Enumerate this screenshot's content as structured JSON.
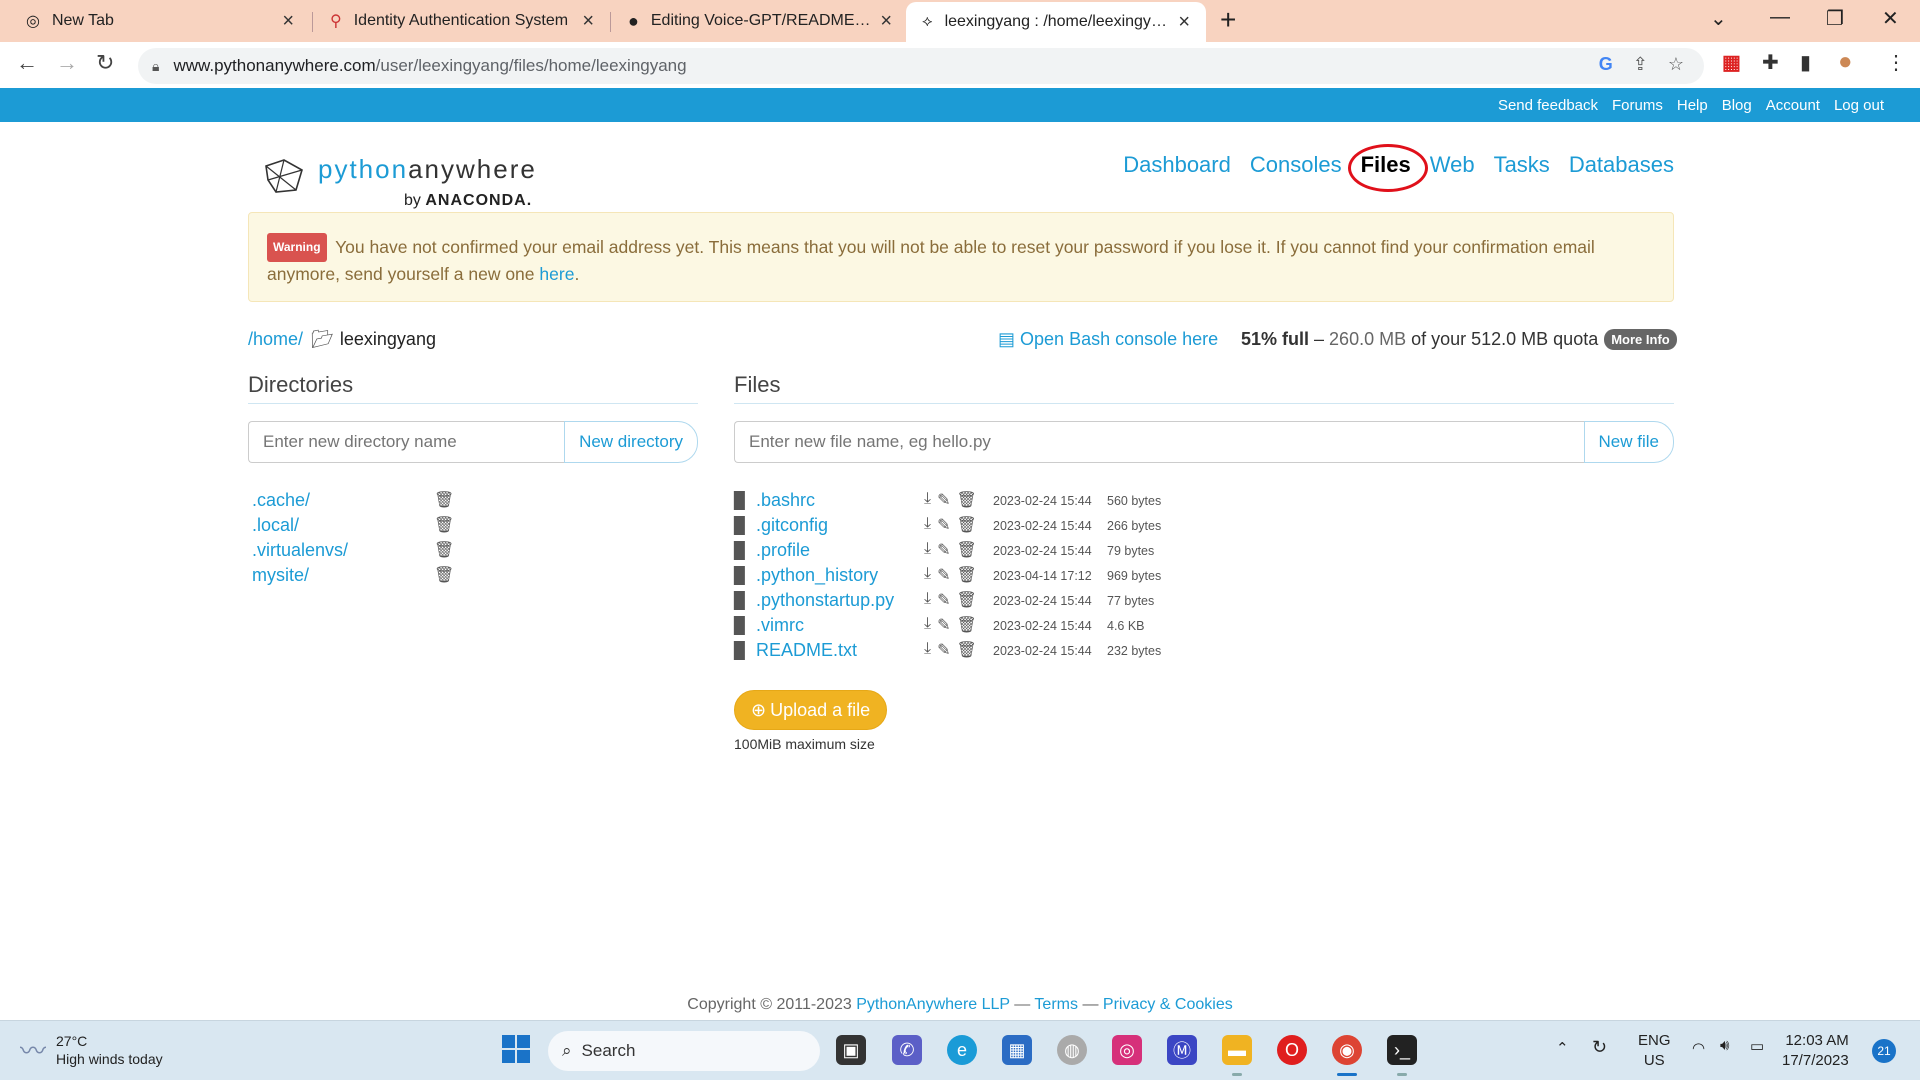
{
  "browser": {
    "tabs": [
      {
        "label": "New Tab",
        "icon": "chrome-icon"
      },
      {
        "label": "Identity Authentication System",
        "icon": "map-pin-icon"
      },
      {
        "label": "Editing Voice-GPT/README.md a",
        "icon": "github-icon"
      },
      {
        "label": "leexingyang : /home/leexingyang",
        "icon": "pythonanywhere-icon",
        "active": true
      }
    ],
    "url_host": "www.pythonanywhere.com",
    "url_path": "/user/leexingyang/files/home/leexingyang"
  },
  "pa_topbar": {
    "links": [
      "Send feedback",
      "Forums",
      "Help",
      "Blog",
      "Account",
      "Log out"
    ]
  },
  "logo": {
    "python": "python",
    "anywhere": "anywhere",
    "by": "by",
    "anaconda": "ANACONDA."
  },
  "nav": {
    "items": [
      "Dashboard",
      "Consoles",
      "Files",
      "Web",
      "Tasks",
      "Databases"
    ],
    "current": "Files"
  },
  "warning": {
    "badge": "Warning",
    "text": "You have not confirmed your email address yet. This means that you will not be able to reset your password if you lose it. If you cannot find your confirmation email anymore, send yourself a new one",
    "link": "here",
    "tail": "."
  },
  "breadcrumb": {
    "root": "/home/",
    "current": "leexingyang"
  },
  "bash_link": "Open Bash console here",
  "quota": {
    "percent": "51% full",
    "dash": "–",
    "used": "260.0 MB",
    "of_text": "of your 512.0 MB quota",
    "more_info": "More Info"
  },
  "directories": {
    "title": "Directories",
    "placeholder": "Enter new directory name",
    "button": "New directory",
    "items": [
      ".cache/",
      ".local/",
      ".virtualenvs/",
      "mysite/"
    ]
  },
  "files": {
    "title": "Files",
    "placeholder": "Enter new file name, eg hello.py",
    "button": "New file",
    "items": [
      {
        "name": ".bashrc",
        "date": "2023-02-24 15:44",
        "size": "560 bytes"
      },
      {
        "name": ".gitconfig",
        "date": "2023-02-24 15:44",
        "size": "266 bytes"
      },
      {
        "name": ".profile",
        "date": "2023-02-24 15:44",
        "size": "79 bytes"
      },
      {
        "name": ".python_history",
        "date": "2023-04-14 17:12",
        "size": "969 bytes"
      },
      {
        "name": ".pythonstartup.py",
        "date": "2023-02-24 15:44",
        "size": "77 bytes"
      },
      {
        "name": ".vimrc",
        "date": "2023-02-24 15:44",
        "size": "4.6 KB"
      },
      {
        "name": "README.txt",
        "date": "2023-02-24 15:44",
        "size": "232 bytes"
      }
    ],
    "upload_button": "Upload a file",
    "upload_note": "100MiB maximum size"
  },
  "footer": {
    "copyright": "Copyright © 2011-2023",
    "company": "PythonAnywhere LLP",
    "sep1": "—",
    "terms": "Terms",
    "sep2": "—",
    "privacy": "Privacy & Cookies"
  },
  "taskbar": {
    "temperature": "27°C",
    "weather": "High winds today",
    "search": "Search",
    "lang_top": "ENG",
    "lang_bottom": "US",
    "time": "12:03 AM",
    "date": "17/7/2023",
    "notifications": "21"
  },
  "colors": {
    "brand_blue": "#1c9bd5",
    "warning_bg": "#fcf8e3",
    "upload_orange": "#f0b322",
    "highlight_red": "#e0101a"
  }
}
